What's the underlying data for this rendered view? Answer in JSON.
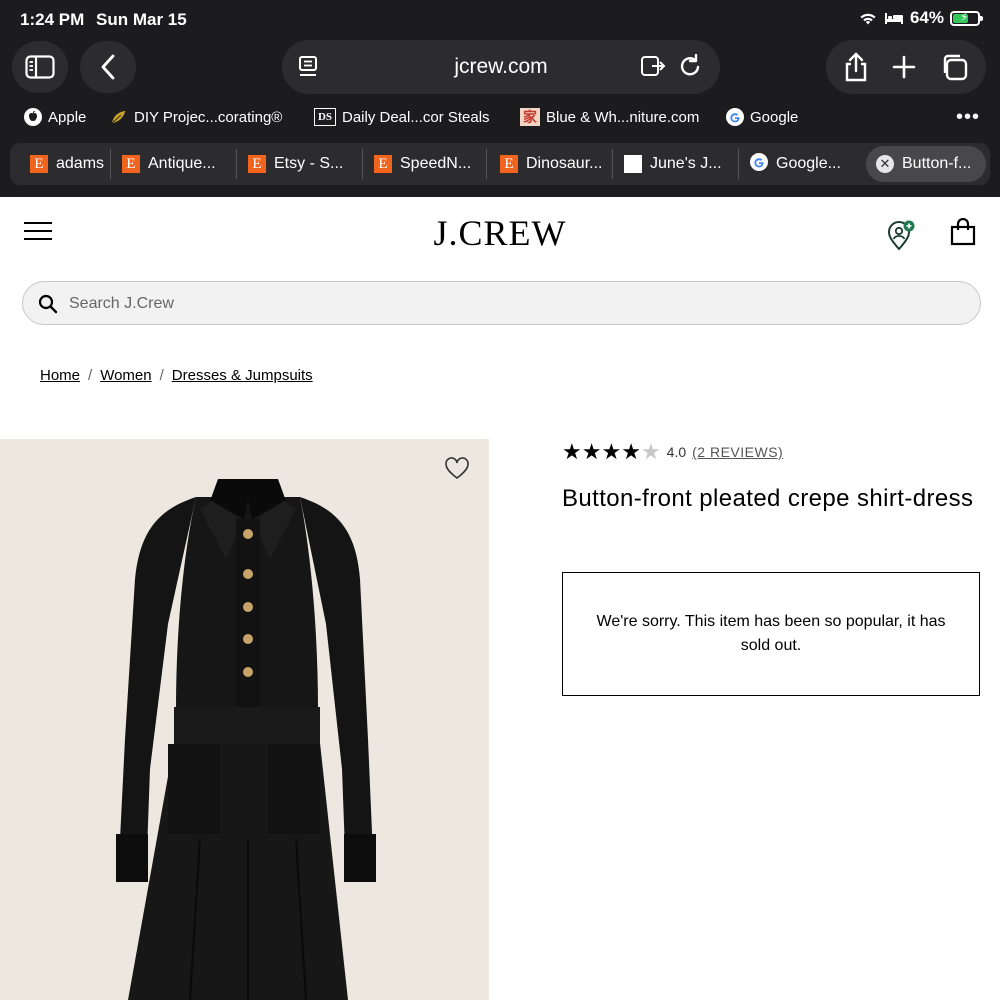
{
  "status_bar": {
    "time": "1:24 PM",
    "date": "Sun Mar 15",
    "battery": "64%",
    "battery_level": 0.64
  },
  "toolbar": {
    "url": "jcrew.com"
  },
  "bookmarks": [
    {
      "label": "Apple",
      "icon": "apple-icon"
    },
    {
      "label": "DIY Projec...corating®",
      "icon": "leaf-icon"
    },
    {
      "label": "Daily Deal...cor Steals",
      "icon": "ds-icon",
      "icon_text": "DS"
    },
    {
      "label": "Blue & Wh...niture.com",
      "icon": "jia-icon",
      "icon_text": "家"
    },
    {
      "label": "Google",
      "icon": "google-icon"
    }
  ],
  "tabs": [
    {
      "label": "adams",
      "icon": "etsy-icon",
      "icon_text": "E"
    },
    {
      "label": "Antique...",
      "icon": "etsy-icon",
      "icon_text": "E"
    },
    {
      "label": "Etsy - S...",
      "icon": "etsy-icon",
      "icon_text": "E"
    },
    {
      "label": "SpeedN...",
      "icon": "etsy-icon",
      "icon_text": "E"
    },
    {
      "label": "Dinosaur...",
      "icon": "etsy-icon",
      "icon_text": "E"
    },
    {
      "label": "June's J...",
      "icon": "blank-page-icon"
    },
    {
      "label": "Google...",
      "icon": "google-icon"
    },
    {
      "label": "Button-f...",
      "icon": "close-icon",
      "active": true
    }
  ],
  "site": {
    "logo": "J.CREW",
    "search": {
      "placeholder": "Search J.Crew",
      "value": ""
    },
    "breadcrumb": [
      "Home",
      "Women",
      "Dresses & Jumpsuits"
    ],
    "breadcrumb_sep": "/"
  },
  "product": {
    "rating": 4.0,
    "rating_text": "4.0",
    "reviews_text": "(2 REVIEWS)",
    "title": "Button-front pleated crepe shirt-dress",
    "sold_out_message": "We're sorry. This item has been so popular, it has sold out."
  },
  "colors": {
    "chrome_bg": "#1c1c1e",
    "chrome_control": "#2c2c2e",
    "etsy": "#f1641e",
    "battery": "#34c759",
    "photo_bg": "#ece8df"
  }
}
